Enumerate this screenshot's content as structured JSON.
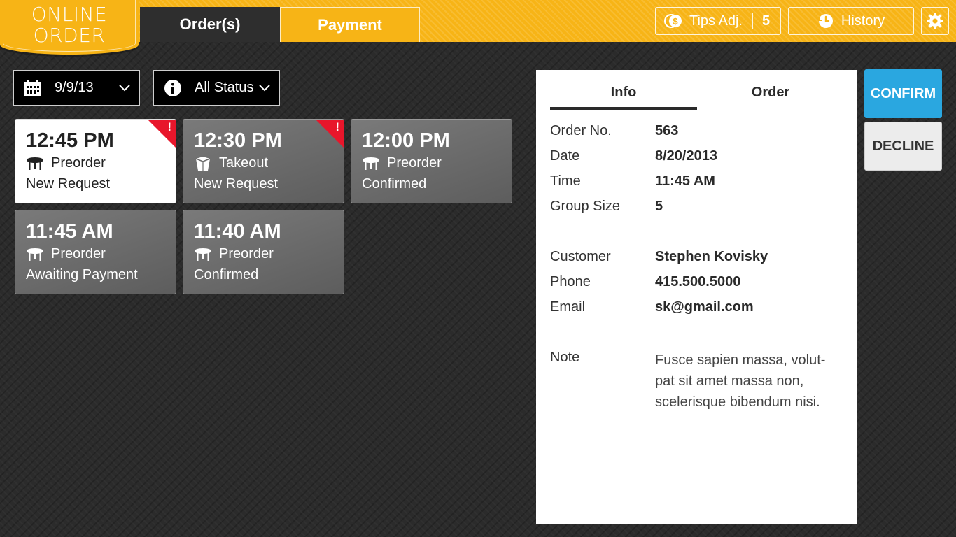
{
  "app": {
    "logo_line1": "ONLINE",
    "logo_line2": "ORDER",
    "accent_color": "#f7b416",
    "confirm_color": "#2aa7e0",
    "alert_color": "#e8162b"
  },
  "nav": {
    "tabs": [
      {
        "label": "Order(s)",
        "active": true
      },
      {
        "label": "Payment",
        "active": false
      }
    ],
    "tips": {
      "label": "Tips Adj.",
      "count": "5",
      "icon": "coins-icon"
    },
    "history": {
      "label": "History",
      "icon": "history-clock-icon"
    },
    "settings": {
      "icon": "gear-icon"
    }
  },
  "filters": {
    "date": {
      "value": "9/9/13",
      "icon": "calendar-icon"
    },
    "status": {
      "value": "All Status",
      "icon": "info-icon"
    }
  },
  "orders": [
    {
      "time": "12:45 PM",
      "type": "Preorder",
      "type_icon": "table-icon",
      "status": "New Request",
      "alert": "!",
      "selected": true
    },
    {
      "time": "12:30 PM",
      "type": "Takeout",
      "type_icon": "takeout-box-icon",
      "status": "New Request",
      "alert": "!",
      "selected": false
    },
    {
      "time": "12:00 PM",
      "type": "Preorder",
      "type_icon": "table-icon",
      "status": "Confirmed",
      "selected": false
    },
    {
      "time": "11:45 AM",
      "type": "Preorder",
      "type_icon": "table-icon",
      "status": "Awaiting Payment",
      "selected": false
    },
    {
      "time": "11:40 AM",
      "type": "Preorder",
      "type_icon": "table-icon",
      "status": "Confirmed",
      "selected": false
    }
  ],
  "detail": {
    "tabs": [
      {
        "label": "Info",
        "active": true
      },
      {
        "label": "Order",
        "active": false
      }
    ],
    "fields": {
      "order_no": {
        "label": "Order No.",
        "value": "563"
      },
      "date": {
        "label": "Date",
        "value": "8/20/2013"
      },
      "time": {
        "label": "Time",
        "value": "11:45 AM"
      },
      "group_size": {
        "label": "Group Size",
        "value": "5"
      },
      "customer": {
        "label": "Customer",
        "value": "Stephen Kovisky"
      },
      "phone": {
        "label": "Phone",
        "value": "415.500.5000"
      },
      "email": {
        "label": "Email",
        "value": "sk@gmail.com"
      },
      "note": {
        "label": "Note",
        "value": "Fusce sapien massa, volut-pat sit amet massa non, scelerisque bibendum nisi."
      }
    }
  },
  "actions": {
    "confirm": "CONFIRM",
    "decline": "DECLINE"
  }
}
